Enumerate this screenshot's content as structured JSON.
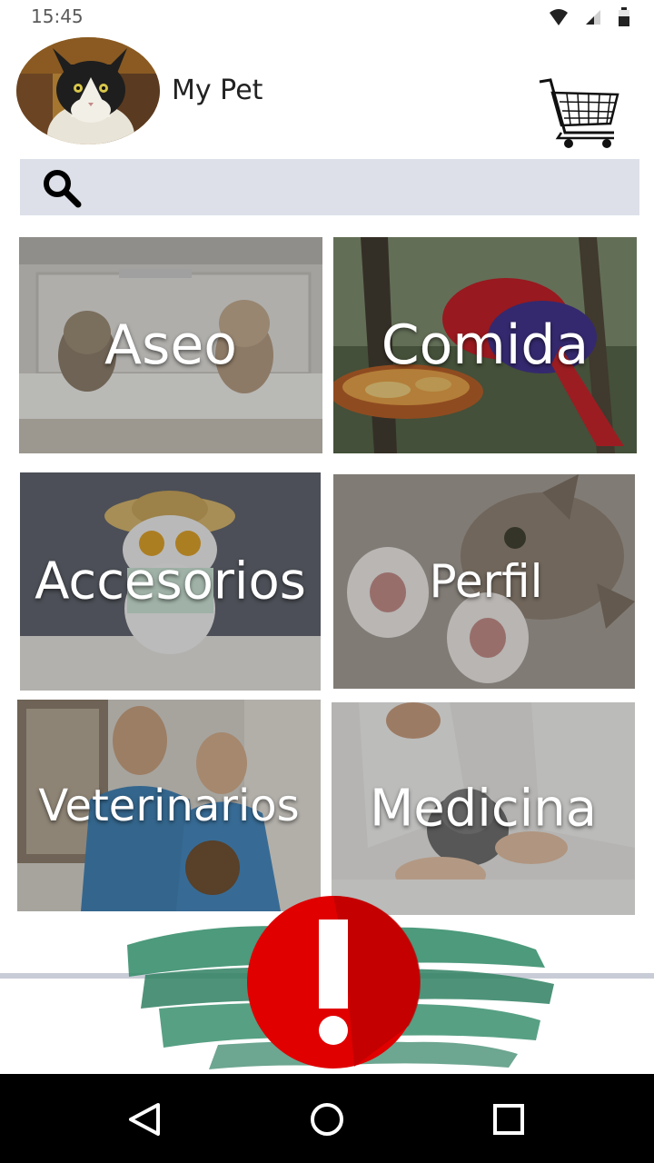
{
  "status_bar": {
    "time": "15:45",
    "icons": [
      "wifi-icon",
      "signal-icon",
      "battery-icon"
    ]
  },
  "header": {
    "title": "My Pet",
    "avatar_icon": "cat-avatar-icon",
    "cart_icon": "shopping-cart-icon"
  },
  "search": {
    "icon": "search-icon",
    "placeholder": "",
    "value": ""
  },
  "categories": [
    {
      "label": "Aseo"
    },
    {
      "label": "Comida"
    },
    {
      "label": "Accesorios"
    },
    {
      "label": "Perfil"
    },
    {
      "label": "Veterinarios"
    },
    {
      "label": "Medicina"
    }
  ],
  "alert": {
    "icon": "exclamation-icon",
    "color": "#e00000"
  },
  "nav_bar": {
    "icons": [
      "back-triangle-icon",
      "home-circle-icon",
      "recents-square-icon"
    ]
  },
  "colors": {
    "search_bg": "#dde0e8",
    "brush_green": "#3a8f6e",
    "alert_red": "#e00000"
  }
}
